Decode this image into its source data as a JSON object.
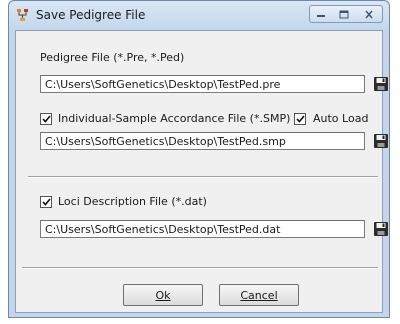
{
  "window": {
    "title": "Save Pedigree File",
    "controls": {
      "minimize": "minimize-icon",
      "maximize": "maximize-icon",
      "close": "close-icon"
    }
  },
  "pedigree": {
    "label": "Pedigree File (*.Pre, *.Ped)",
    "path": "C:\\Users\\SoftGenetics\\Desktop\\TestPed.pre"
  },
  "sample": {
    "label": "Individual-Sample Accordance File (*.SMP)",
    "checked": true,
    "auto_load_label": "Auto Load",
    "auto_load_checked": true,
    "path": "C:\\Users\\SoftGenetics\\Desktop\\TestPed.smp"
  },
  "loci": {
    "label": "Loci Description File (*.dat)",
    "checked": true,
    "path": "C:\\Users\\SoftGenetics\\Desktop\\TestPed.dat"
  },
  "buttons": {
    "ok": "Ok",
    "cancel": "Cancel"
  },
  "icons": {
    "app": "pedigree-app-icon",
    "save": "floppy-disk-icon",
    "check": "checkmark-icon"
  }
}
